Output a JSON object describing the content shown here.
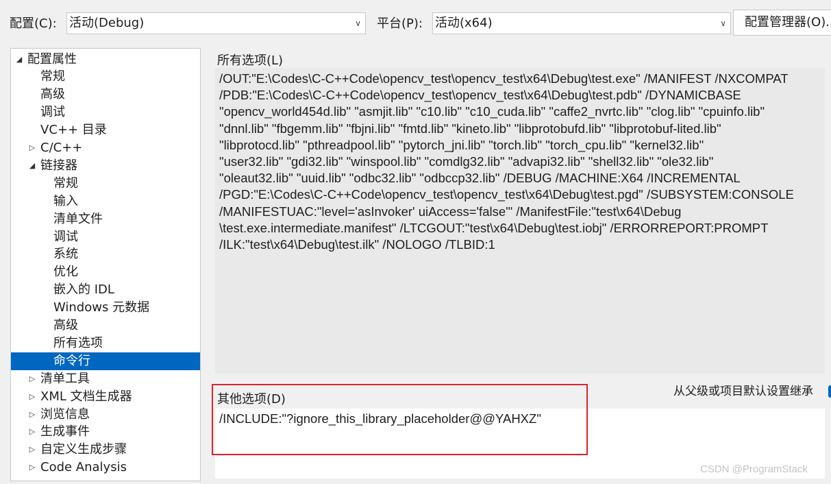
{
  "toolbar": {
    "config_label": "配置(C):",
    "config_value": "活动(Debug)",
    "platform_label": "平台(P):",
    "platform_value": "活动(x64)",
    "config_manager": "配置管理器(O)..."
  },
  "tree": {
    "items": [
      {
        "label": "配置属性",
        "twisty": "expanded"
      },
      {
        "label": "常规"
      },
      {
        "label": "高级"
      },
      {
        "label": "调试"
      },
      {
        "label": "VC++ 目录"
      },
      {
        "label": "C/C++",
        "twisty": "collapsed"
      },
      {
        "label": "链接器",
        "twisty": "expanded"
      },
      {
        "label": "常规"
      },
      {
        "label": "输入"
      },
      {
        "label": "清单文件"
      },
      {
        "label": "调试"
      },
      {
        "label": "系统"
      },
      {
        "label": "优化"
      },
      {
        "label": "嵌入的 IDL"
      },
      {
        "label": "Windows 元数据"
      },
      {
        "label": "高级"
      },
      {
        "label": "所有选项"
      },
      {
        "label": "命令行",
        "selected": true
      },
      {
        "label": "清单工具",
        "twisty": "collapsed"
      },
      {
        "label": "XML 文档生成器",
        "twisty": "collapsed"
      },
      {
        "label": "浏览信息",
        "twisty": "collapsed"
      },
      {
        "label": "生成事件",
        "twisty": "collapsed"
      },
      {
        "label": "自定义生成步骤",
        "twisty": "collapsed"
      },
      {
        "label": "Code Analysis",
        "twisty": "collapsed"
      }
    ]
  },
  "all_options": {
    "label": "所有选项(L)",
    "lines": [
      "/OUT:\"E:\\Codes\\C-C++Code\\opencv_test\\opencv_test\\x64\\Debug\\test.exe\" /MANIFEST /NXCOMPAT",
      "/PDB:\"E:\\Codes\\C-C++Code\\opencv_test\\opencv_test\\x64\\Debug\\test.pdb\" /DYNAMICBASE",
      "\"opencv_world454d.lib\" \"asmjit.lib\" \"c10.lib\" \"c10_cuda.lib\" \"caffe2_nvrtc.lib\" \"clog.lib\" \"cpuinfo.lib\"",
      "\"dnnl.lib\" \"fbgemm.lib\" \"fbjni.lib\" \"fmtd.lib\" \"kineto.lib\" \"libprotobufd.lib\" \"libprotobuf-lited.lib\"",
      "\"libprotocd.lib\" \"pthreadpool.lib\" \"pytorch_jni.lib\" \"torch.lib\" \"torch_cpu.lib\" \"kernel32.lib\"",
      "\"user32.lib\" \"gdi32.lib\" \"winspool.lib\" \"comdlg32.lib\" \"advapi32.lib\" \"shell32.lib\" \"ole32.lib\"",
      "\"oleaut32.lib\" \"uuid.lib\" \"odbc32.lib\" \"odbccp32.lib\" /DEBUG /MACHINE:X64 /INCREMENTAL",
      "/PGD:\"E:\\Codes\\C-C++Code\\opencv_test\\opencv_test\\x64\\Debug\\test.pgd\" /SUBSYSTEM:CONSOLE",
      "/MANIFESTUAC:\"level='asInvoker' uiAccess='false'\" /ManifestFile:\"test\\x64\\Debug",
      "\\test.exe.intermediate.manifest\" /LTCGOUT:\"test\\x64\\Debug\\test.iobj\" /ERRORREPORT:PROMPT",
      "/ILK:\"test\\x64\\Debug\\test.ilk\" /NOLOGO /TLBID:1"
    ]
  },
  "other_options": {
    "label": "其他选项(D)",
    "value": "/INCLUDE:\"?ignore_this_library_placeholder@@YAHXZ\"",
    "inherit_label": "从父级或项目默认设置继承"
  },
  "watermark": "CSDN @ProgramStack",
  "colors": {
    "selection": "#0067c0",
    "highlight_border": "#d9232d"
  }
}
